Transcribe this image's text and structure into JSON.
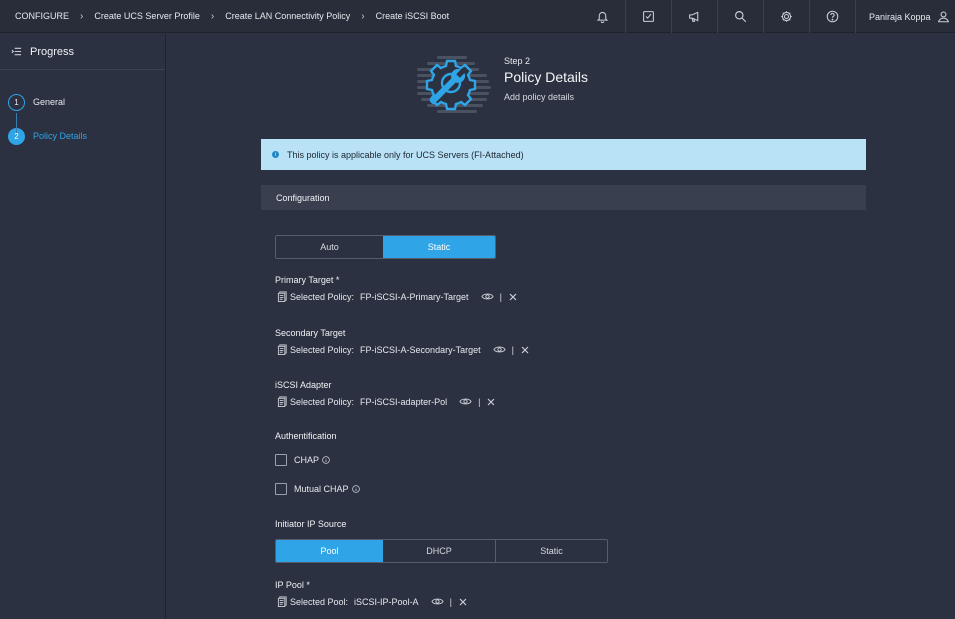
{
  "breadcrumb": [
    {
      "label": "CONFIGURE"
    },
    {
      "label": "Create UCS Server Profile"
    },
    {
      "label": "Create LAN Connectivity Policy"
    },
    {
      "label": "Create iSCSI Boot"
    }
  ],
  "topbar_icons": [
    "bell-icon",
    "tasks-check-icon",
    "megaphone-icon",
    "search-icon",
    "gear-icon",
    "help-icon"
  ],
  "user": {
    "name": "Paniraja Koppa"
  },
  "sidebar": {
    "title": "Progress",
    "steps": [
      {
        "number": "1",
        "label": "General",
        "active": false
      },
      {
        "number": "2",
        "label": "Policy Details",
        "active": true
      }
    ]
  },
  "header": {
    "step": "Step 2",
    "title": "Policy Details",
    "subtitle": "Add policy details"
  },
  "info_banner": "This policy is applicable only for UCS Servers (FI-Attached)",
  "configuration": {
    "title": "Configuration",
    "mode_options": [
      "Auto",
      "Static"
    ],
    "mode_selected": "Static"
  },
  "primary_target": {
    "label": "Primary Target *",
    "prefix": "Selected Policy:",
    "value": "FP-iSCSI-A-Primary-Target"
  },
  "secondary_target": {
    "label": "Secondary Target",
    "prefix": "Selected Policy:",
    "value": "FP-iSCSI-A-Secondary-Target"
  },
  "iscsi_adapter": {
    "label": "iSCSI Adapter",
    "prefix": "Selected Policy:",
    "value": "FP-iSCSI-adapter-Pol"
  },
  "authentication": {
    "label": "Authentification",
    "options": [
      {
        "label": "CHAP",
        "checked": false
      },
      {
        "label": "Mutual CHAP",
        "checked": false
      }
    ]
  },
  "initiator_ip_source": {
    "label": "Initiator IP Source",
    "options": [
      "Pool",
      "DHCP",
      "Static"
    ],
    "selected": "Pool"
  },
  "ip_pool": {
    "label": "IP Pool *",
    "prefix": "Selected Pool:",
    "value": "iSCSI-IP-Pool-A"
  },
  "colors": {
    "accent": "#2fa4e7",
    "background": "#2b3140",
    "banner": "#b9e2f7",
    "section_header": "#393f4e"
  }
}
